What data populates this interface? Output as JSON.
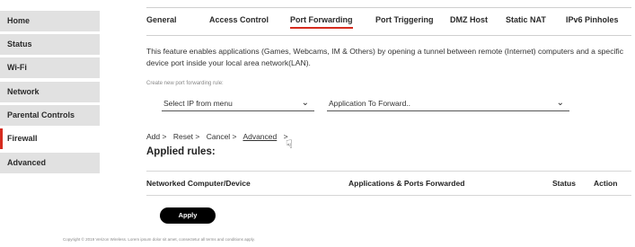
{
  "sidebar": {
    "items": [
      {
        "label": "Home"
      },
      {
        "label": "Status"
      },
      {
        "label": "Wi-Fi"
      },
      {
        "label": "Network"
      },
      {
        "label": "Parental Controls"
      },
      {
        "label": "Firewall"
      },
      {
        "label": "Advanced"
      }
    ],
    "active": "Firewall"
  },
  "tabs": [
    {
      "label": "General"
    },
    {
      "label": "Access Control"
    },
    {
      "label": "Port Forwarding"
    },
    {
      "label": "Port Triggering"
    },
    {
      "label": "DMZ Host"
    },
    {
      "label": "Static NAT"
    },
    {
      "label": "IPv6 Pinholes"
    }
  ],
  "active_tab": "Port Forwarding",
  "description": "This feature enables applications (Games, Webcams, IM & Others) by opening a tunnel between remote (Internet) computers and a specific device port inside your local area network(LAN).",
  "create_rule_label": "Create new port forwarding rule:",
  "select_ip": {
    "value": "Select IP from menu"
  },
  "select_app": {
    "value": "Application To Forward.."
  },
  "actions": {
    "add": "Add >",
    "reset": "Reset >",
    "cancel": "Cancel >",
    "advanced": "Advanced",
    "advanced_arrow": ">"
  },
  "applied_title": "Applied rules:",
  "table_headers": {
    "device": "Networked Computer/Device",
    "apps_ports": "Applications & Ports Forwarded",
    "status": "Status",
    "action": "Action"
  },
  "apply_label": "Apply",
  "footer": "Copyright © 2019 Verizon Wireless. Lorem ipsum dolor sit amet, consectetur all terms and conditions apply.",
  "colors": {
    "accent": "#d52b1e",
    "sidebar_bg": "#e1e1e1"
  },
  "icons": [
    "chevron-down-icon",
    "hand-cursor-icon"
  ]
}
